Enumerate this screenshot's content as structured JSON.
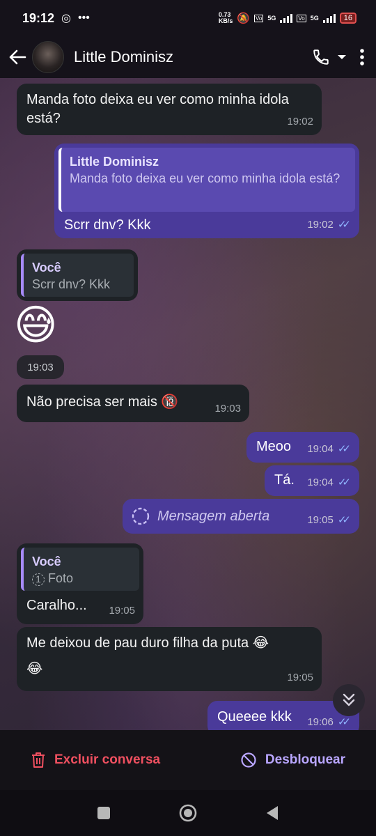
{
  "status": {
    "time": "19:12",
    "net_speed": "0.73\nKB/s",
    "net_label_1": "5G",
    "net_label_2": "5G",
    "battery": "16"
  },
  "header": {
    "contact_name": "Little Dominisz"
  },
  "messages": {
    "m1": {
      "text": "Manda foto deixa eu ver como minha idola está?",
      "time": "19:02"
    },
    "m2": {
      "reply_name": "Little Dominisz",
      "reply_text": "Manda foto deixa eu ver como minha idola está?",
      "text": "Scrr dnv? Kkk",
      "time": "19:02"
    },
    "m3": {
      "reply_name": "Você",
      "reply_text": "Scrr dnv? Kkk"
    },
    "m4": {
      "emoji": "😅",
      "time": "19:03"
    },
    "m5": {
      "text": "Não precisa ser mais",
      "emoji": "🔞",
      "time": "19:03"
    },
    "m6": {
      "text": "Meoo",
      "time": "19:04"
    },
    "m7": {
      "text": "Tá.",
      "time": "19:04"
    },
    "m8": {
      "text": "Mensagem aberta",
      "time": "19:05"
    },
    "m9": {
      "reply_name": "Você",
      "reply_text": "Foto",
      "text": "Caralho...",
      "time": "19:05"
    },
    "m10": {
      "text": "Me deixou de pau duro filha da puta",
      "emoji1": "😂",
      "emoji2": "😂",
      "time": "19:05"
    },
    "m11": {
      "text": "Queeee kkk",
      "time": "19:06"
    }
  },
  "actions": {
    "delete_label": "Excluir conversa",
    "unblock_label": "Desbloquear"
  },
  "colors": {
    "incoming_bubble": "#1e2226",
    "outgoing_bubble": "#4a3a9a",
    "delete_red": "#f05060",
    "unblock_purple": "#b9a6ff",
    "read_ticks": "#8fb4ff"
  }
}
